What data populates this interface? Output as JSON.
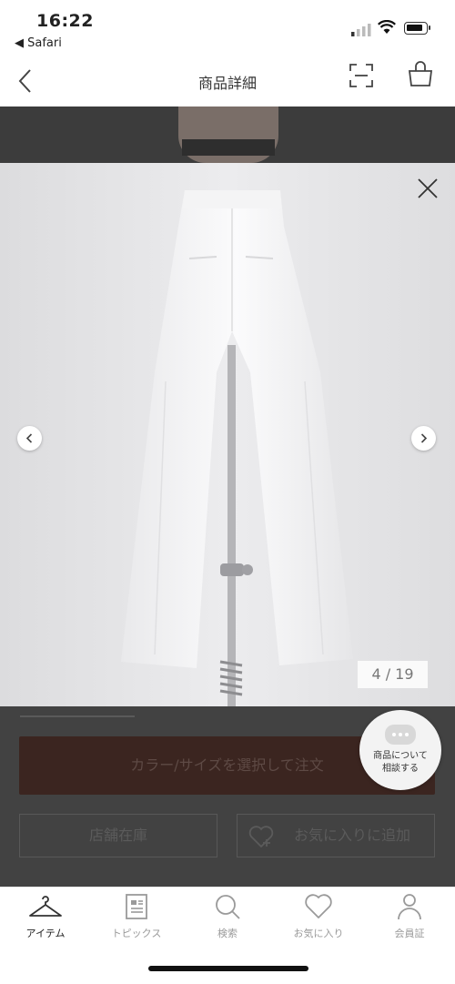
{
  "status_bar": {
    "time": "16:22",
    "back_app": "◀ Safari"
  },
  "nav": {
    "title": "商品詳細"
  },
  "gallery": {
    "counter": "4 / 19"
  },
  "actions": {
    "select_label": "カラー/サイズを選択して注文",
    "store_stock_label": "店舗在庫",
    "favorite_add_label": "お気に入りに追加"
  },
  "chat": {
    "line1": "商品について",
    "line2": "相談する"
  },
  "tabs": [
    {
      "label": "アイテム",
      "icon": "hanger-icon",
      "active": true
    },
    {
      "label": "トピックス",
      "icon": "news-icon",
      "active": false
    },
    {
      "label": "検索",
      "icon": "search-icon",
      "active": false
    },
    {
      "label": "お気に入り",
      "icon": "heart-icon",
      "active": false
    },
    {
      "label": "会員証",
      "icon": "person-icon",
      "active": false
    }
  ],
  "colors": {
    "button_brown": "#3b2520",
    "overlay_dim": "#424242"
  }
}
